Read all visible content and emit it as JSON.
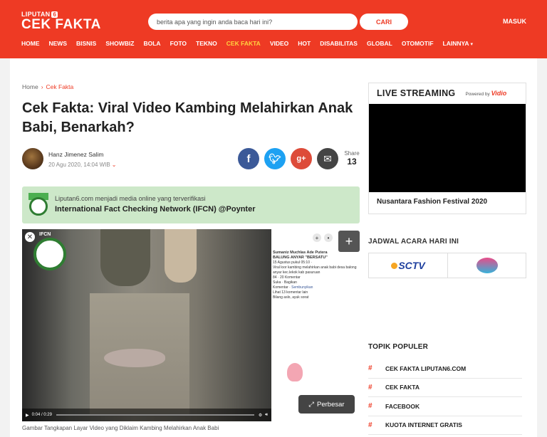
{
  "header": {
    "logo_small": "LIPUTAN",
    "logo_six": "6",
    "logo_big": "CEK FAKTA",
    "search_placeholder": "berita apa yang ingin anda baca hari ini?",
    "search_button": "CARI",
    "login": "MASUK"
  },
  "nav": [
    {
      "label": "HOME"
    },
    {
      "label": "NEWS"
    },
    {
      "label": "BISNIS"
    },
    {
      "label": "SHOWBIZ"
    },
    {
      "label": "BOLA"
    },
    {
      "label": "FOTO"
    },
    {
      "label": "TEKNO"
    },
    {
      "label": "CEK FAKTA",
      "active": true
    },
    {
      "label": "VIDEO"
    },
    {
      "label": "HOT"
    },
    {
      "label": "DISABILITAS"
    },
    {
      "label": "GLOBAL"
    },
    {
      "label": "OTOMOTIF"
    },
    {
      "label": "LAINNYA"
    }
  ],
  "breadcrumb": {
    "home": "Home",
    "current": "Cek Fakta"
  },
  "article": {
    "title": "Cek Fakta: Viral Video Kambing Melahirkan Anak Babi, Benarkah?",
    "author": "Hanz Jimenez Salim",
    "date": "20 Agu 2020, 14:04 WIB",
    "share_label": "Share",
    "share_count": "13"
  },
  "ifcn": {
    "line1": "Liputan6.com menjadi media online yang terverifikasi",
    "line2": "International Fact Checking Network (IFCN) @Poynter"
  },
  "media": {
    "badge_label": "IFCN",
    "time": "0:04 / 0:29",
    "fb_name": "Sumaniz Muchlas Ade Putera",
    "fb_group": "BALUNG ANYAR \"BERSATU\"",
    "fb_time": "15 Agustus pukul 05:10 ·",
    "fb_text": "Viral loor kambing melahirkan anak babi desa balong anyar kec.lekok kab pasuruan",
    "fb_likes": "84",
    "fb_comments": "20 Komentar",
    "fb_like_btn": "Suka",
    "fb_share_btn": "Bagikan",
    "fb_comment_label": "Komentar",
    "fb_hide": "Sembunyikan",
    "fb_more": "Lihat 13 komentar lain",
    "fb_reply": "Bilang aslo, ayuk sorat",
    "zoom_label": "Perbesar",
    "caption": "Gambar Tangkapan Layar Video yang Diklaim Kambing Melahirkan Anak Babi"
  },
  "sidebar": {
    "live_title": "LIVE STREAMING",
    "powered_by": "Powered by",
    "powered_brand": "Vidio",
    "live_caption": "Nusantara Fashion Festival 2020",
    "schedule_title": "JADWAL ACARA HARI INI",
    "channel1": "SCTV",
    "topik_title": "TOPIK POPULER",
    "topics": [
      {
        "label": "CEK FAKTA LIPUTAN6.COM"
      },
      {
        "label": "CEK FAKTA"
      },
      {
        "label": "FACEBOOK"
      },
      {
        "label": "KUOTA INTERNET GRATIS"
      }
    ]
  },
  "colors": {
    "brand": "#ee3a24",
    "accent_nav": "#ffd23f",
    "ifcn_bg": "#cde8c9"
  }
}
